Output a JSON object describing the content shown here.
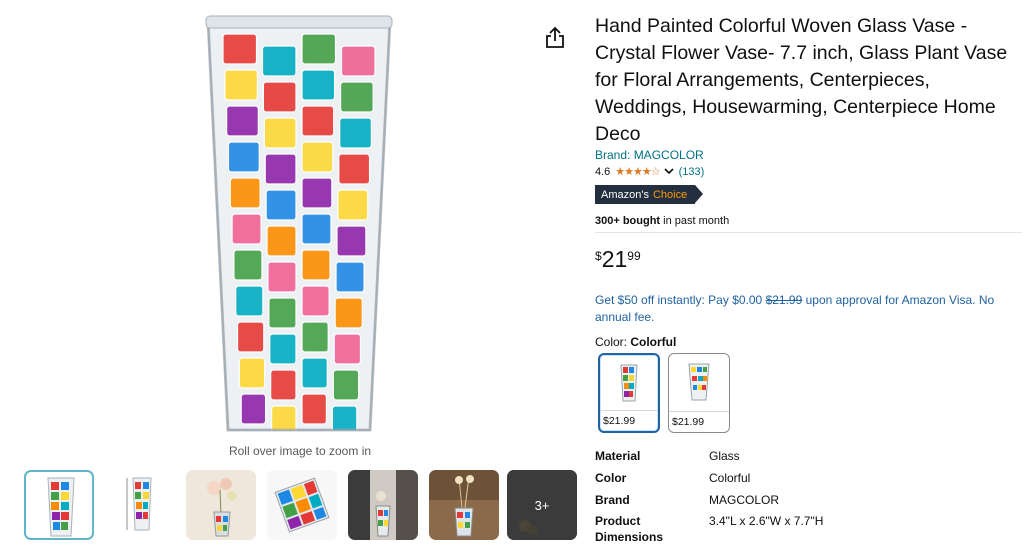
{
  "gallery": {
    "zoom_hint": "Roll over image to zoom in",
    "more_label": "3+"
  },
  "product": {
    "title": "Hand Painted Colorful Woven Glass Vase - Crystal Flower Vase- 7.7 inch, Glass Plant Vase for Floral Arrangements, Centerpieces, Weddings, Housewarming, Centerpiece Home Deco",
    "brand": "Brand: MAGCOLOR",
    "rating": "4.6",
    "stars": "★★★★☆",
    "rating_count": "(133)",
    "badge_prefix": "Amazon's",
    "badge_choice": "Choice",
    "bought_bold": "300+ bought",
    "bought_rest": " in past month"
  },
  "price": {
    "symbol": "$",
    "whole": "21",
    "fraction": "99"
  },
  "promo": {
    "before": "Get $50 off instantly: Pay $0.00 ",
    "strike": "$21.99",
    "after": " upon approval for Amazon Visa. No annual fee."
  },
  "color": {
    "label": "Color: ",
    "value": "Colorful",
    "options": [
      {
        "price": "$21.99"
      },
      {
        "price": "$21.99"
      }
    ]
  },
  "specs": [
    {
      "key": "Material",
      "value": "Glass"
    },
    {
      "key": "Color",
      "value": "Colorful"
    },
    {
      "key": "Brand",
      "value": "MAGCOLOR"
    },
    {
      "key": "Product Dimensions",
      "value": "3.4\"L x 2.6\"W x 7.7\"H"
    }
  ],
  "colors": {
    "link": "#007185",
    "promo": "#2162a1",
    "star": "#de7921",
    "badge_bg": "#232f3e",
    "badge_accent": "#ff9900"
  },
  "icons": [
    "share-icon",
    "chevron-down-icon"
  ]
}
